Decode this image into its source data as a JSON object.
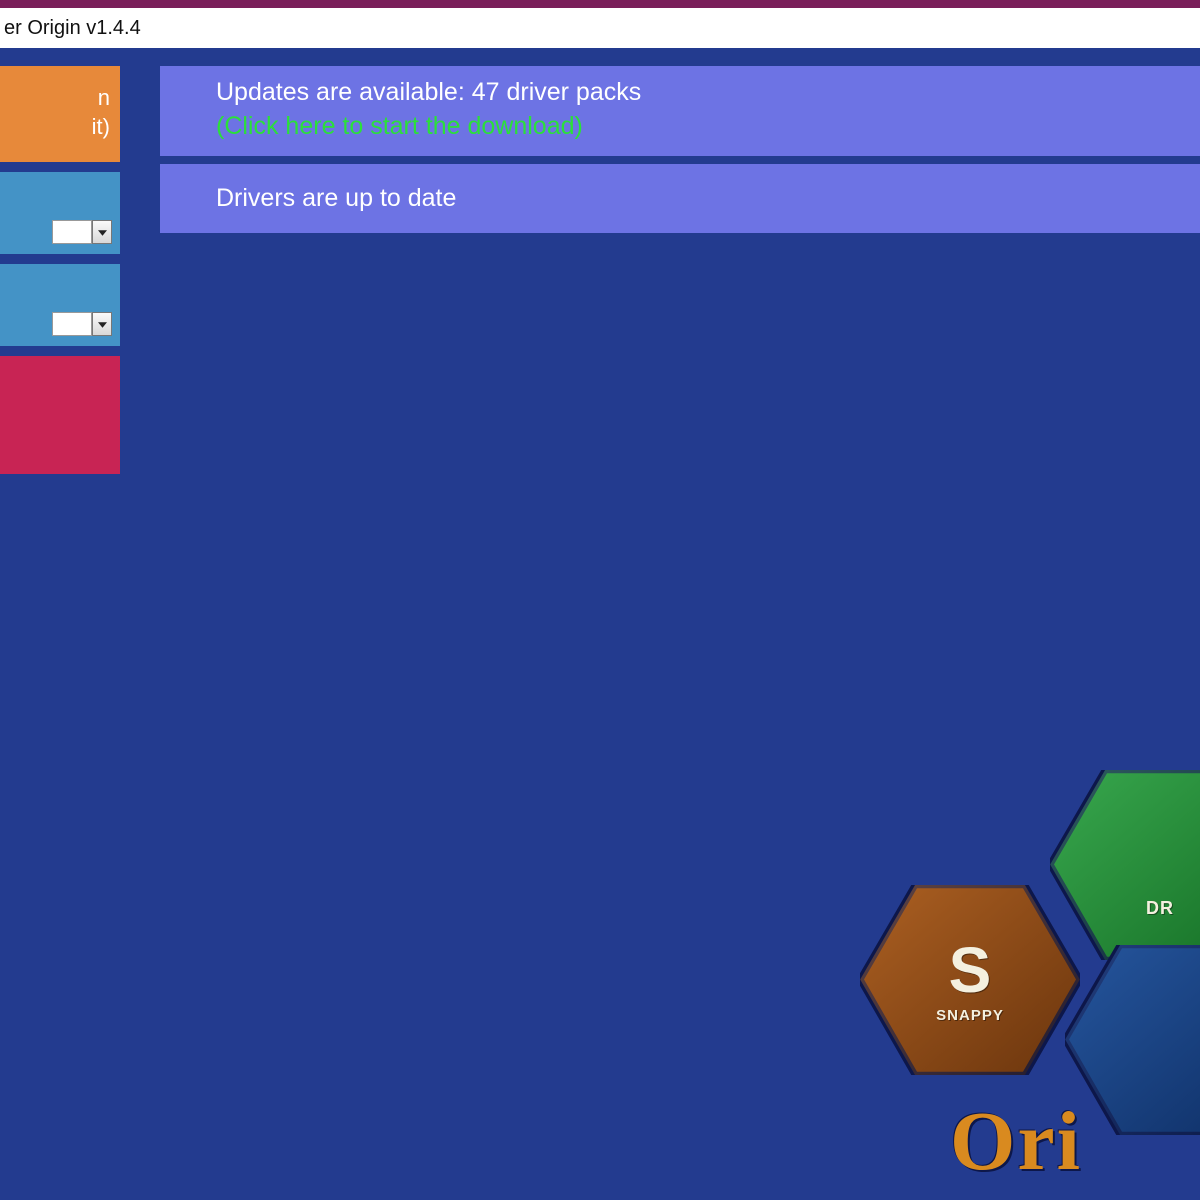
{
  "window": {
    "title_fragment": "er Origin v1.4.4"
  },
  "sidebar": {
    "orange_line1": "n",
    "orange_line2": "it)"
  },
  "status": {
    "updates_line": "Updates are available: 47 driver packs",
    "updates_sub": "(Click here to start the download)",
    "drivers_line": "Drivers are up to date"
  },
  "logo": {
    "snappy_big": "S",
    "snappy_small": "SNAPPY",
    "driver_small": "DR",
    "origin": "Ori"
  }
}
